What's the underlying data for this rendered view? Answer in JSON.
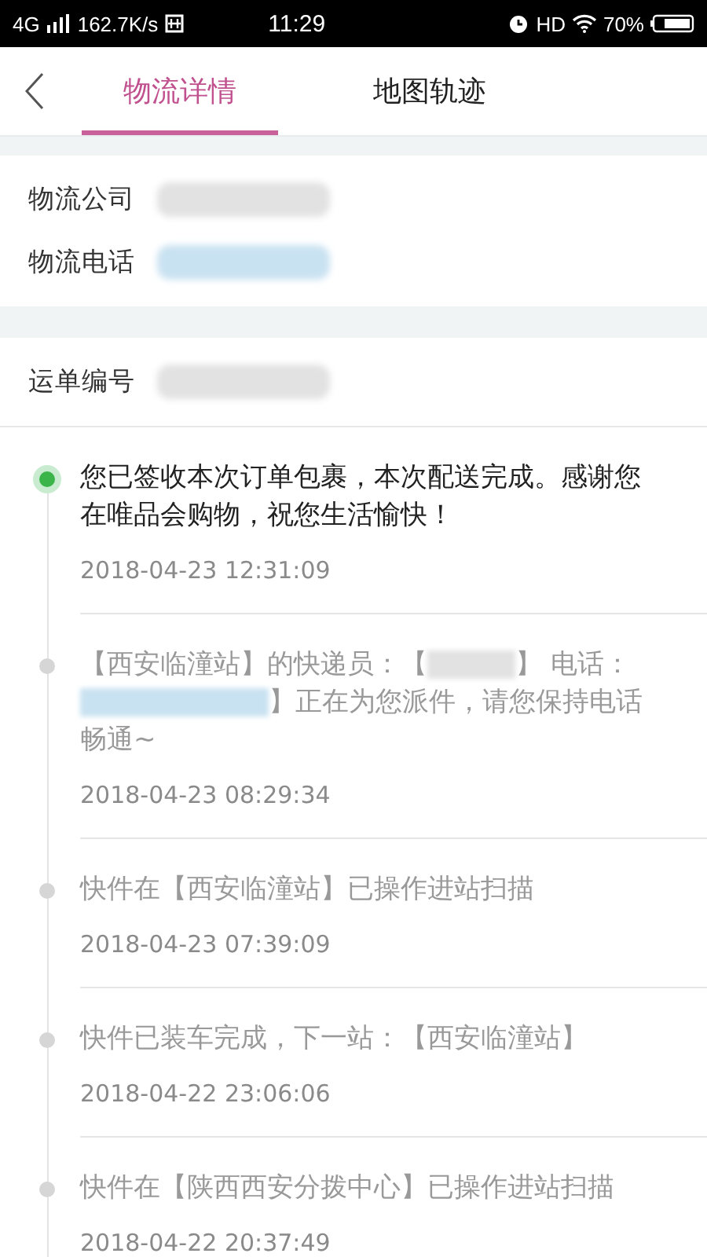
{
  "status_bar": {
    "network": "4G",
    "speed": "162.7K/s",
    "time": "11:29",
    "hd": "HD",
    "battery": "70%"
  },
  "tabs": [
    {
      "label": "物流详情",
      "selected": true
    },
    {
      "label": "地图轨迹",
      "selected": false
    }
  ],
  "carrier_info": [
    {
      "label": "物流公司",
      "kind": "text"
    },
    {
      "label": "物流电话",
      "kind": "phone"
    }
  ],
  "waybill": {
    "label": "运单编号"
  },
  "events": [
    {
      "current": true,
      "parts": [
        {
          "kind": "text",
          "text": "您已签收本次订单包裹，本次配送完成。感谢您在唯品会购物，祝您生活愉快！"
        }
      ],
      "time": "2018-04-23 12:31:09"
    },
    {
      "current": false,
      "parts": [
        {
          "kind": "text",
          "text": "【西安临潼站】的快递员：【"
        },
        {
          "kind": "redacted"
        },
        {
          "kind": "text",
          "text": "】 电话："
        },
        {
          "kind": "redacted_phone"
        },
        {
          "kind": "text",
          "text": "】正在为您派件，请您保持电话畅通~"
        }
      ],
      "time": "2018-04-23 08:29:34"
    },
    {
      "current": false,
      "parts": [
        {
          "kind": "text",
          "text": "快件在【西安临潼站】已操作进站扫描"
        }
      ],
      "time": "2018-04-23 07:39:09"
    },
    {
      "current": false,
      "parts": [
        {
          "kind": "text",
          "text": "快件已装车完成，下一站：【西安临潼站】"
        }
      ],
      "time": "2018-04-22 23:06:06"
    },
    {
      "current": false,
      "parts": [
        {
          "kind": "text",
          "text": "快件在【陕西西安分拨中心】已操作进站扫描"
        }
      ],
      "time": "2018-04-22 20:37:49"
    }
  ]
}
